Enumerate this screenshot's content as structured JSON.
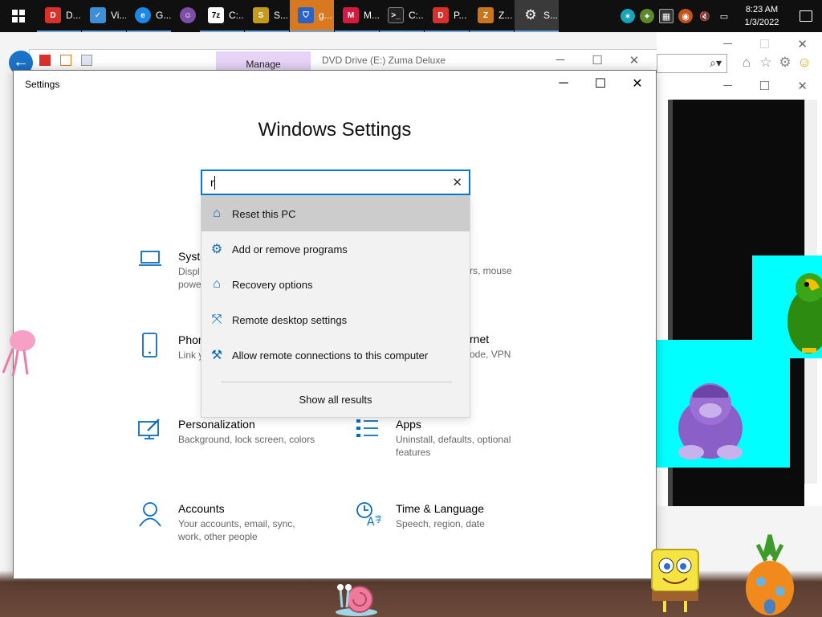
{
  "taskbar": {
    "apps": [
      {
        "label": "D...",
        "icon": "daemon-tools-icon",
        "color": "#d8312c"
      },
      {
        "label": "Vi...",
        "icon": "file-explorer-icon",
        "color": "#3e8fd6"
      },
      {
        "label": "G...",
        "icon": "internet-explorer-icon",
        "color": "#1e88e5"
      },
      {
        "label": "",
        "icon": "bonzi-buddy-icon",
        "color": "#7b4fa8"
      },
      {
        "label": "C:...",
        "icon": "7zip-icon",
        "color": "#333333"
      },
      {
        "label": "S...",
        "icon": "vb-script-icon",
        "color": "#c49a1c"
      },
      {
        "label": "g...",
        "icon": "uac-shield-icon",
        "color": "#ffd23f"
      },
      {
        "label": "M...",
        "icon": "malwarebytes-icon",
        "color": "#d7193f"
      },
      {
        "label": "C:...",
        "icon": "command-prompt-icon",
        "color": "#222222"
      },
      {
        "label": "P...",
        "icon": "daemon-tools-icon",
        "color": "#d8312c"
      },
      {
        "label": "Z...",
        "icon": "zuma-icon",
        "color": "#c8751d"
      },
      {
        "label": "S...",
        "icon": "settings-gear-icon",
        "color": "#6d6d6d"
      }
    ],
    "clock": {
      "time": "8:23 AM",
      "date": "1/3/2022"
    }
  },
  "explorer": {
    "manage_label": "Manage",
    "title": "DVD Drive (E:) Zuma Deluxe"
  },
  "settings": {
    "window_title": "Settings",
    "heading": "Windows Settings",
    "search": {
      "value": "r",
      "suggestions": [
        {
          "label": "Reset this PC",
          "icon": "laptop-reset-icon"
        },
        {
          "label": "Add or remove programs",
          "icon": "gear-icon"
        },
        {
          "label": "Recovery options",
          "icon": "laptop-reset-icon"
        },
        {
          "label": "Remote desktop settings",
          "icon": "remote-desktop-icon"
        },
        {
          "label": "Allow remote connections to this computer",
          "icon": "tools-icon"
        }
      ],
      "show_all": "Show all results"
    },
    "categories": [
      {
        "name": "Syste",
        "desc": "Displ\npowe",
        "icon": "laptop-icon"
      },
      {
        "name": "Phon",
        "desc": "Link y",
        "icon": "phone-icon"
      },
      {
        "name": "Personalization",
        "desc": "Background, lock screen, colors",
        "icon": "personalization-icon"
      },
      {
        "name": "Apps",
        "desc": "Uninstall, defaults, optional features",
        "icon": "apps-icon"
      },
      {
        "name": "Accounts",
        "desc": "Your accounts, email, sync, work, other people",
        "icon": "person-icon"
      },
      {
        "name": "Time & Language",
        "desc": "Speech, region, date",
        "icon": "time-language-icon"
      }
    ],
    "partial_right": {
      "devices_desc_tail": "rs, mouse",
      "network_name_tail": "rnet",
      "network_desc_tail": "ode, VPN"
    }
  }
}
